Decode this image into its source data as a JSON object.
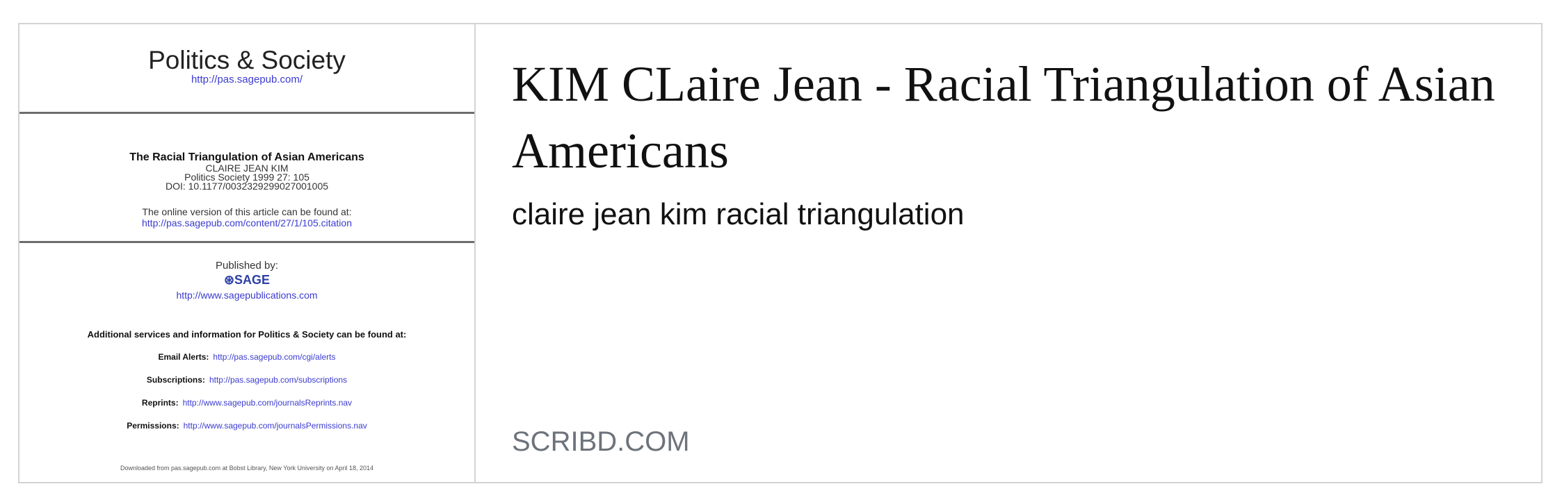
{
  "thumbnail": {
    "journal_title": "Politics & Society",
    "journal_url": "http://pas.sagepub.com/",
    "article_title": "The Racial Triangulation of Asian Americans",
    "author": "CLAIRE JEAN KIM",
    "citation": "Politics Society 1999 27: 105",
    "doi": "DOI: 10.1177/0032329299027001005",
    "online_note": "The online version of this article can be found at:",
    "online_url": "http://pas.sagepub.com/content/27/1/105.citation",
    "published_by": "Published by:",
    "publisher_logo": "SAGE",
    "publisher_url": "http://www.sagepublications.com",
    "additional_services": "Additional services and information for Politics & Society can be found at:",
    "services": [
      {
        "label": "Email Alerts:",
        "url": "http://pas.sagepub.com/cgi/alerts"
      },
      {
        "label": "Subscriptions:",
        "url": "http://pas.sagepub.com/subscriptions"
      },
      {
        "label": "Reprints:",
        "url": "http://www.sagepub.com/journalsReprints.nav"
      },
      {
        "label": "Permissions:",
        "url": "http://www.sagepub.com/journalsPermissions.nav"
      }
    ],
    "download_note": "Downloaded from pas.sagepub.com at Bobst Library, New York University on April 18, 2014"
  },
  "card": {
    "title": "KIM CLaire Jean - Racial Triangulation of Asian Americans",
    "description": "claire jean kim racial triangulation",
    "domain": "SCRIBD.COM"
  }
}
